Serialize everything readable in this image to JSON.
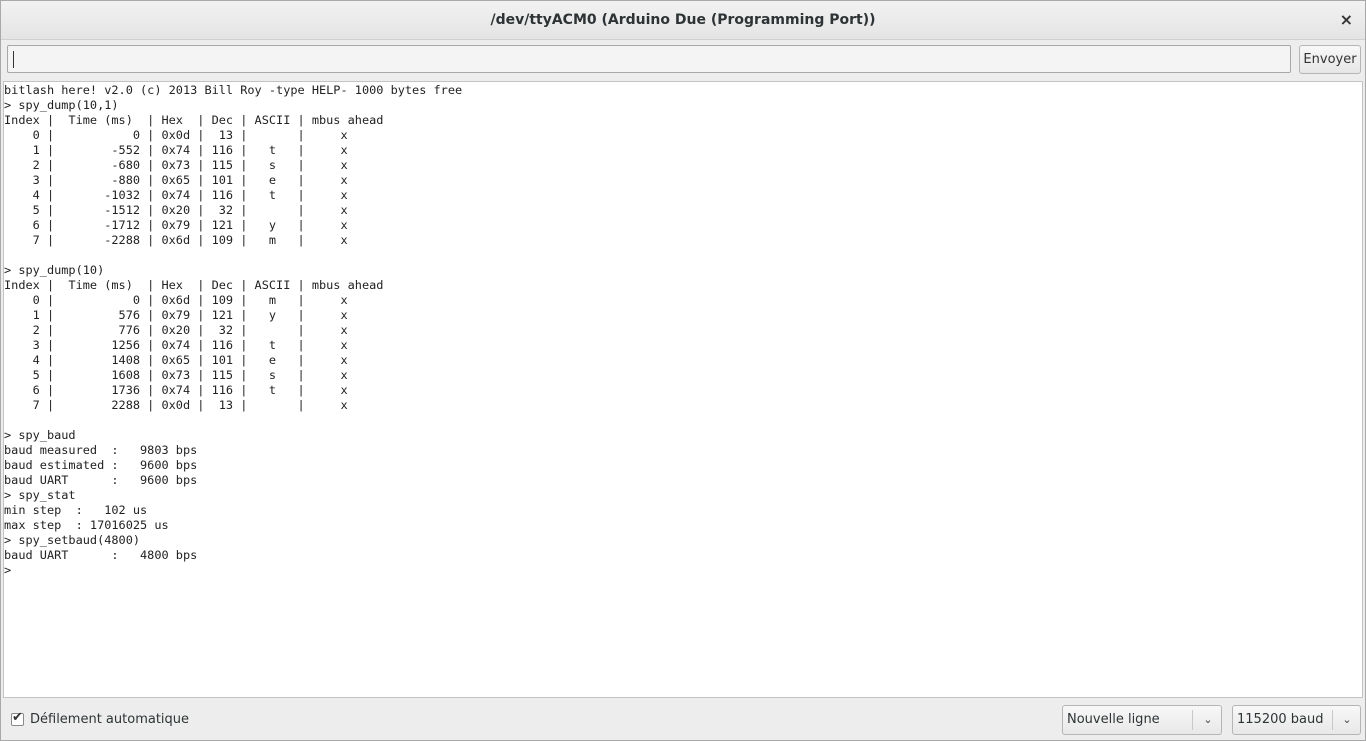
{
  "window": {
    "title": "/dev/ttyACM0 (Arduino Due (Programming Port))",
    "close_icon": "×"
  },
  "send": {
    "input_value": "",
    "button_label": "Envoyer"
  },
  "console": {
    "lines": [
      "bitlash here! v2.0 (c) 2013 Bill Roy -type HELP- 1000 bytes free",
      "> spy_dump(10,1)",
      "Index |  Time (ms)  | Hex  | Dec | ASCII | mbus ahead",
      "    0 |           0 | 0x0d |  13 |       |     x",
      "    1 |        -552 | 0x74 | 116 |   t   |     x",
      "    2 |        -680 | 0x73 | 115 |   s   |     x",
      "    3 |        -880 | 0x65 | 101 |   e   |     x",
      "    4 |       -1032 | 0x74 | 116 |   t   |     x",
      "    5 |       -1512 | 0x20 |  32 |       |     x",
      "    6 |       -1712 | 0x79 | 121 |   y   |     x",
      "    7 |       -2288 | 0x6d | 109 |   m   |     x",
      "",
      "> spy_dump(10)",
      "Index |  Time (ms)  | Hex  | Dec | ASCII | mbus ahead",
      "    0 |           0 | 0x6d | 109 |   m   |     x",
      "    1 |         576 | 0x79 | 121 |   y   |     x",
      "    2 |         776 | 0x20 |  32 |       |     x",
      "    3 |        1256 | 0x74 | 116 |   t   |     x",
      "    4 |        1408 | 0x65 | 101 |   e   |     x",
      "    5 |        1608 | 0x73 | 115 |   s   |     x",
      "    6 |        1736 | 0x74 | 116 |   t   |     x",
      "    7 |        2288 | 0x0d |  13 |       |     x",
      "",
      "> spy_baud",
      "baud measured  :   9803 bps",
      "baud estimated :   9600 bps",
      "baud UART      :   9600 bps",
      "> spy_stat",
      "min step  :   102 us",
      "max step  : 17016025 us",
      "> spy_setbaud(4800)",
      "baud UART      :   4800 bps",
      ">"
    ]
  },
  "footer": {
    "autoscroll_checked": true,
    "checkmark_icon": "✔",
    "autoscroll_label": "Défilement automatique",
    "line_ending_selected": "Nouvelle ligne",
    "baud_selected": "115200 baud",
    "dropdown_icon": "⌄"
  }
}
